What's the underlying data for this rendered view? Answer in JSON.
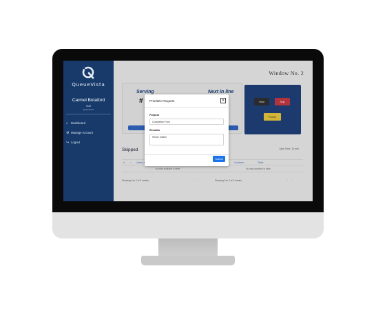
{
  "brand": {
    "logo_text": "QueueVista"
  },
  "user": {
    "name": "Carmel Botaford",
    "role": "Staff",
    "sub": "Applications"
  },
  "sidebar": {
    "items": [
      {
        "label": "Dashboard",
        "icon": "home-icon"
      },
      {
        "label": "Manage Account",
        "icon": "gear-icon"
      },
      {
        "label": "Logout",
        "icon": "logout-icon"
      }
    ]
  },
  "header": {
    "window_title": "Window No. 2"
  },
  "serving": {
    "serving_label": "Serving",
    "next_label": "Next in line",
    "number": "#"
  },
  "controls": {
    "hold_label": "Hold",
    "skip_label": "Skip",
    "priority_label": "Priority"
  },
  "skipped": {
    "title": "Skipped",
    "wait_time": "Max Time: 10 min",
    "left_table": {
      "headers": [
        "#",
        "↑",
        "Queue #"
      ],
      "empty_text": "No data available in table",
      "showing": "Showing 0 to 0 of 0 entries"
    },
    "right_table": {
      "headers": [
        "Queue #",
        "Customer",
        "Ticket"
      ],
      "empty_text": "No data available in table",
      "showing": "Showing 0 to 0 of 0 entries"
    },
    "pager": "‹ ›"
  },
  "modal": {
    "title": "Prioritize Request",
    "close_symbol": "✕",
    "purpose_label": "Purpose",
    "purpose_value": "Completion Form",
    "remarks_label": "Remarks",
    "remarks_value": "Senior Citizen",
    "submit_label": "Submit"
  },
  "colors": {
    "sidebar_bg": "#173a6b",
    "accent_blue": "#1a73e8",
    "skip_red": "#b1343c",
    "priority_yellow": "#d3b637",
    "hold_dark": "#2b2b2b"
  }
}
